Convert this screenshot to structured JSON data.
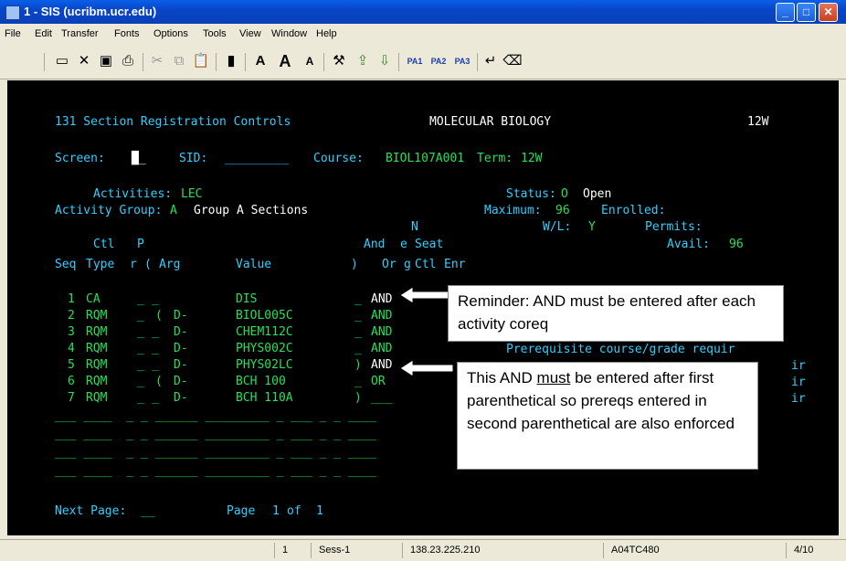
{
  "window": {
    "title": "1 - SIS (ucribm.ucr.edu)"
  },
  "menu": [
    "File",
    "Edit",
    "Transfer",
    "Fonts",
    "Options",
    "Tools",
    "View",
    "Window",
    "Help"
  ],
  "toolbar": {
    "pa1": "PA1",
    "pa2": "PA2",
    "pa3": "PA3"
  },
  "terminal": {
    "header_title": "131 Section Registration Controls",
    "dept": "MOLECULAR BIOLOGY",
    "term_code": "12W",
    "screen_label": "Screen:",
    "sid_label": "SID:",
    "course_label": "Course:",
    "course_value": "BIOL107A001",
    "term_label": "Term:",
    "term_value": "12W",
    "activities_label": "Activities:",
    "activities_value": "LEC",
    "status_label": "Status:",
    "status_code": "O",
    "status_text": "Open",
    "activity_group_label": "Activity Group:",
    "activity_group_value": "A",
    "activity_group_desc": "Group A Sections",
    "maximum_label": "Maximum:",
    "maximum_value": "96",
    "enrolled_label": "Enrolled:",
    "n_label": "N",
    "wl_label": "W/L:",
    "wl_value": "Y",
    "permits_label": "Permits:",
    "ctl_label": "Ctl",
    "p_label": "P",
    "and_label": "And",
    "e_label": "e",
    "seat_label": "Seat",
    "avail_label": "Avail:",
    "avail_value": "96",
    "hdr_seq": "Seq",
    "hdr_type": "Type",
    "hdr_r": "r",
    "hdr_paren": "(",
    "hdr_arg": "Arg",
    "hdr_value": "Value",
    "hdr_close": ")",
    "hdr_or": "Or",
    "hdr_g": "g",
    "hdr_ctl": "Ctl",
    "hdr_enr": "Enr",
    "rows": [
      {
        "seq": "1",
        "type": "CA",
        "p": "_",
        "paren": "_",
        "arg": "",
        "value": "DIS",
        "close": "_",
        "andor": "AND"
      },
      {
        "seq": "2",
        "type": "RQM",
        "p": "_",
        "paren": "(",
        "arg": "D-",
        "value": "BIOL005C",
        "close": "_",
        "andor": "AND"
      },
      {
        "seq": "3",
        "type": "RQM",
        "p": "_",
        "paren": "_",
        "arg": "D-",
        "value": "CHEM112C",
        "close": "_",
        "andor": "AND"
      },
      {
        "seq": "4",
        "type": "RQM",
        "p": "_",
        "paren": "_",
        "arg": "D-",
        "value": "PHYS002C",
        "close": "_",
        "andor": "AND"
      },
      {
        "seq": "5",
        "type": "RQM",
        "p": "_",
        "paren": "_",
        "arg": "D-",
        "value": "PHYS02LC",
        "close": ")",
        "andor": "AND"
      },
      {
        "seq": "6",
        "type": "RQM",
        "p": "_",
        "paren": "(",
        "arg": "D-",
        "value": "BCH 100",
        "close": "_",
        "andor": "OR"
      },
      {
        "seq": "7",
        "type": "RQM",
        "p": "_",
        "paren": "_",
        "arg": "D-",
        "value": "BCH 110A",
        "close": ")",
        "andor": "___"
      }
    ],
    "prereq_text": "Prerequisite course/grade requir",
    "ir_text": "ir",
    "next_page_label": "Next Page:",
    "next_page_value": "__",
    "page_label": "Page",
    "page_current": "1",
    "page_of": "of",
    "page_total": "1"
  },
  "callouts": {
    "reminder": "Reminder:  AND must be entered after each activity coreq",
    "this_and_pre": "This AND ",
    "this_and_must": "must",
    "this_and_post": " be entered after first parenthetical so prereqs entered in second parenthetical are also enforced"
  },
  "statusbar": {
    "num": "1",
    "session": "Sess-1",
    "ip": "138.23.225.210",
    "lu": "A04TC480",
    "pos": "4/10"
  }
}
